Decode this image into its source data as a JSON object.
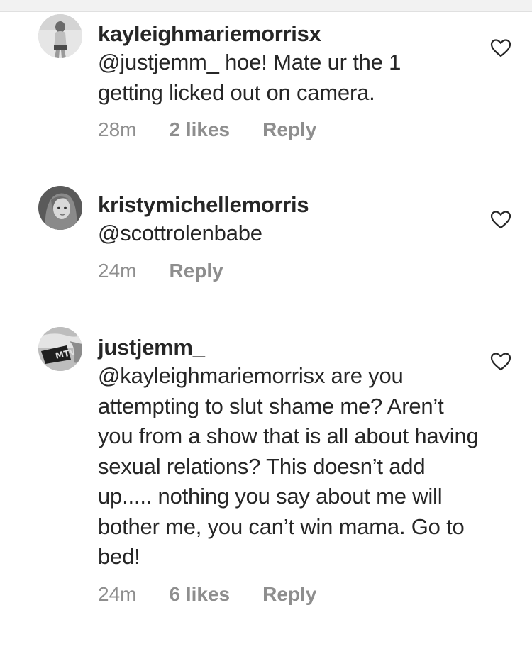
{
  "comments": [
    {
      "username": "kayleighmariemorrisx",
      "text": "@justjemm_ hoe! Mate ur the 1 getting licked out on camera.",
      "time": "28m",
      "likes": "2 likes",
      "reply": "Reply"
    },
    {
      "username": "kristymichellemorris",
      "text": "@scottrolenbabe",
      "time": "24m",
      "likes": "",
      "reply": "Reply"
    },
    {
      "username": "justjemm_",
      "text": "@kayleighmariemorrisx are you attempting to slut shame me? Aren’t you from a show that is all about having sexual relations? This doesn’t add up..... nothing you say about me will bother me, you can’t win mama. Go to bed!",
      "time": "24m",
      "likes": "6 likes",
      "reply": "Reply"
    }
  ],
  "icons": {
    "like": "heart-outline-icon",
    "avatar_badge_text": "MTV"
  },
  "colors": {
    "text": "#262626",
    "meta": "#8e8e8e",
    "background": "#ffffff"
  }
}
